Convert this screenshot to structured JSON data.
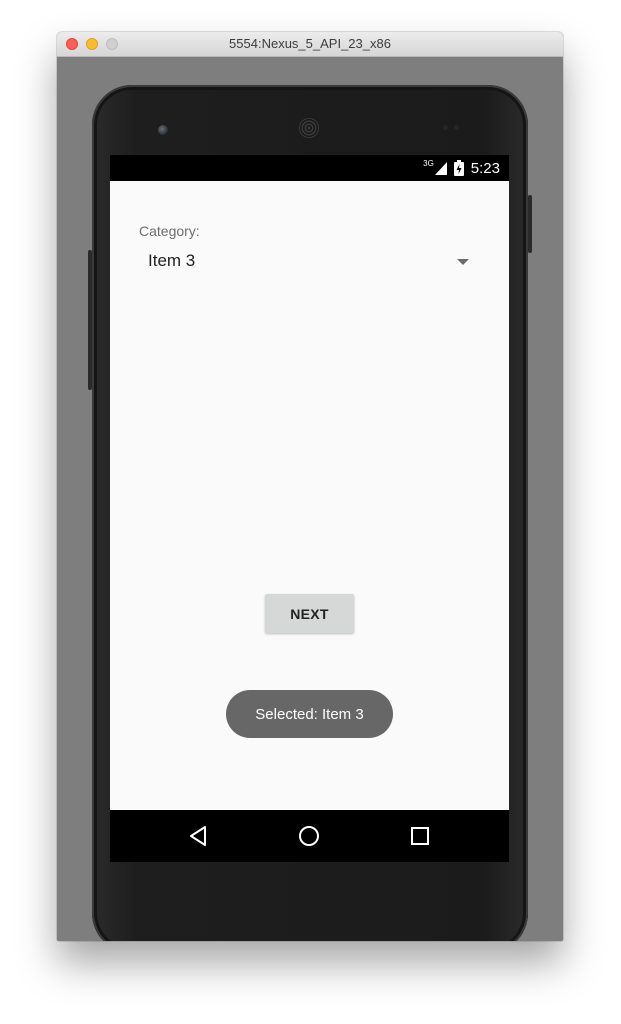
{
  "window": {
    "title": "5554:Nexus_5_API_23_x86"
  },
  "status_bar": {
    "network_type": "3G",
    "time": "5:23",
    "icons": [
      "signal-icon",
      "battery-icon"
    ]
  },
  "form": {
    "category_label": "Category:",
    "category_selected": "Item 3"
  },
  "buttons": {
    "next_label": "NEXT"
  },
  "toast": {
    "message": "Selected: Item 3"
  },
  "nav_bar": {
    "icons": [
      "back-icon",
      "home-icon",
      "recents-icon"
    ]
  },
  "colors": {
    "screen_background": "#fafafa",
    "button_background": "#d6d7d7",
    "toast_background": "#676767",
    "bars": "#000000"
  }
}
